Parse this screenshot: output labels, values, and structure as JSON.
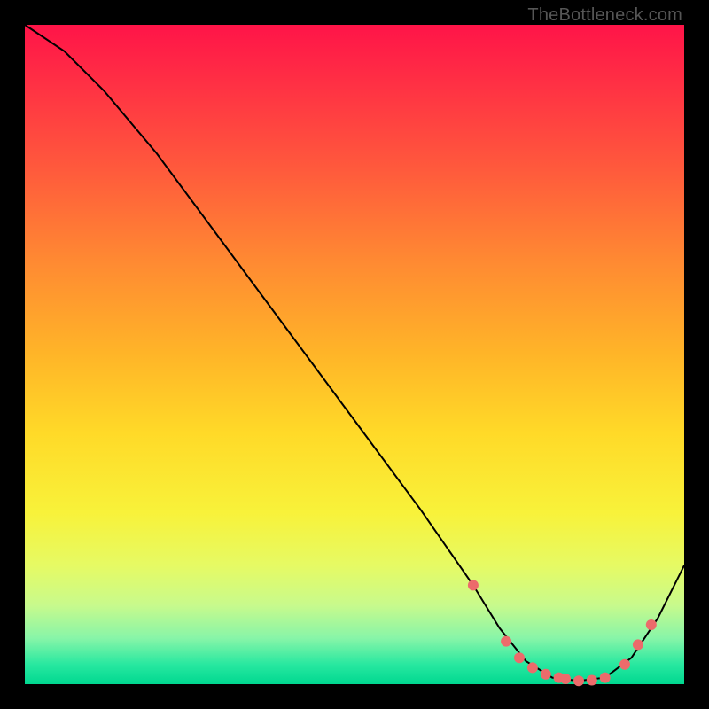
{
  "watermark": "TheBottleneck.com",
  "chart_data": {
    "type": "line",
    "title": "",
    "xlabel": "",
    "ylabel": "",
    "xlim": [
      0,
      100
    ],
    "ylim": [
      0,
      100
    ],
    "curve": {
      "x": [
        0,
        6,
        12,
        20,
        30,
        40,
        50,
        60,
        68,
        72,
        76,
        80,
        84,
        88,
        92,
        96,
        100
      ],
      "y": [
        100,
        96,
        90,
        80.5,
        67,
        53.5,
        40,
        26.5,
        15,
        8.5,
        3.5,
        1,
        0.5,
        1,
        4,
        10,
        18
      ]
    },
    "series": [
      {
        "name": "markers",
        "x": [
          68,
          73,
          75,
          77,
          79,
          81,
          82,
          84,
          86,
          88,
          91,
          93,
          95
        ],
        "y": [
          15,
          6.5,
          4,
          2.5,
          1.5,
          1,
          0.8,
          0.5,
          0.6,
          1,
          3,
          6,
          9
        ]
      }
    ],
    "colors": {
      "curve": "#000000",
      "markers": "#ec6b6b",
      "gradient_top": "#ff1448",
      "gradient_bottom": "#00d890"
    }
  }
}
